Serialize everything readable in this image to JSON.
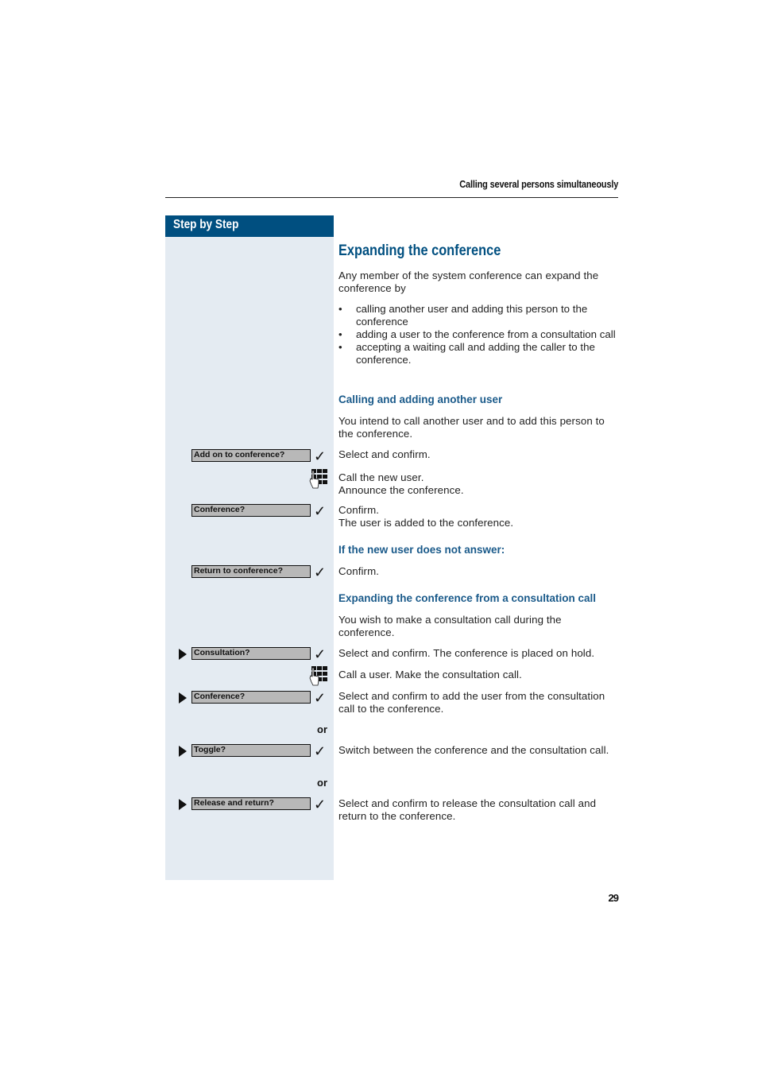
{
  "header": {
    "title": "Calling several persons simultaneously"
  },
  "sidebar": {
    "title": "Step by Step"
  },
  "main": {
    "heading": "Expanding the conference",
    "intro": "Any member of the system conference can expand the conference by",
    "bullets": [
      "calling another user and adding this person to the conference",
      "adding a user to the conference from a consultation call",
      "accepting a waiting call and adding the caller to the conference."
    ],
    "section1": {
      "heading": "Calling and adding another user",
      "intro": "You intend to call another user and to add this person to the conference.",
      "steps": [
        {
          "display": "Add on to conference?",
          "icon": "check-icon",
          "text": "Select and confirm."
        },
        {
          "icon": "keypad-icon",
          "text": "Call the new user.",
          "text2": "Announce the conference."
        },
        {
          "display": "Conference?",
          "icon": "check-icon",
          "text": "Confirm.",
          "text2": "The user is added to the conference."
        }
      ]
    },
    "section2": {
      "heading": "If the new user does not answer:",
      "steps": [
        {
          "display": "Return to conference?",
          "icon": "check-icon",
          "text": "Confirm."
        }
      ]
    },
    "section3": {
      "heading": "Expanding the conference from a consultation call",
      "intro": "You wish to make a consultation call during the conference.",
      "steps": [
        {
          "display": "Consultation?",
          "icon": "check-icon",
          "text": "Select and confirm. The conference is placed on hold."
        },
        {
          "icon": "keypad-icon",
          "text": "Call a user. Make the consultation call."
        },
        {
          "display": "Conference?",
          "icon": "check-icon",
          "text": "Select and confirm to add the user from the consultation call to the conference."
        },
        {
          "display": "Toggle?",
          "icon": "check-icon",
          "text": "Switch between the conference and the consultation call."
        },
        {
          "display": "Release and return?",
          "icon": "check-icon",
          "text": "Select and confirm to release the consultation call and return to the conference."
        }
      ],
      "or_label": "or"
    }
  },
  "footer": {
    "page_number": "29"
  },
  "colors": {
    "brand_blue": "#004f80",
    "sidebar_bg": "#e4ebf2",
    "display_bg": "#b8b8b8"
  }
}
